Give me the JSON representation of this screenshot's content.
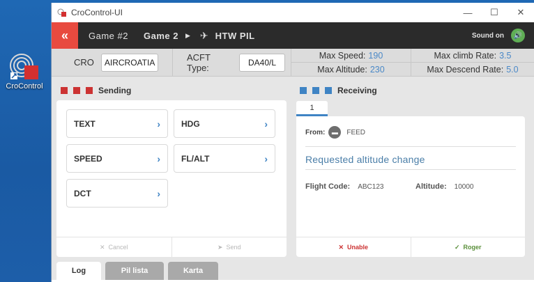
{
  "desktop": {
    "icon_label": "CroControl"
  },
  "window": {
    "title": "CroControl-UI",
    "controls": {
      "minimize": "—",
      "maximize": "☐",
      "close": "✕"
    }
  },
  "navbar": {
    "back_symbol": "«",
    "game_label": "Game #2",
    "game_name": "Game 2",
    "flight": "HTW PIL",
    "sound_label": "Sound on",
    "accent_color": "#e84a3f"
  },
  "infobar": {
    "cro_label": "CRO",
    "cro_value": "AIRCROATIA",
    "acft_label": "ACFT Type:",
    "acft_value": "DA40/L",
    "max_speed_label": "Max Speed:",
    "max_speed_value": "190",
    "max_altitude_label": "Max Altitude:",
    "max_altitude_value": "230",
    "max_climb_label": "Max climb Rate:",
    "max_climb_value": "3.5",
    "max_descend_label": "Max Descend Rate:",
    "max_descend_value": "5.0"
  },
  "sending": {
    "title": "Sending",
    "commands": [
      "TEXT",
      "HDG",
      "SPEED",
      "FL/ALT",
      "DCT"
    ],
    "cancel_label": "Cancel",
    "send_label": "Send"
  },
  "receiving": {
    "title": "Receiving",
    "tab_label": "1",
    "from_label": "From:",
    "from_value": "FEED",
    "request_title": "Requested altitude change",
    "flight_code_label": "Flight Code:",
    "flight_code_value": "ABC123",
    "altitude_label": "Altitude:",
    "altitude_value": "10000",
    "unable_label": "Unable",
    "roger_label": "Roger"
  },
  "bottom_tabs": [
    "Log",
    "Pil lista",
    "Karta"
  ]
}
